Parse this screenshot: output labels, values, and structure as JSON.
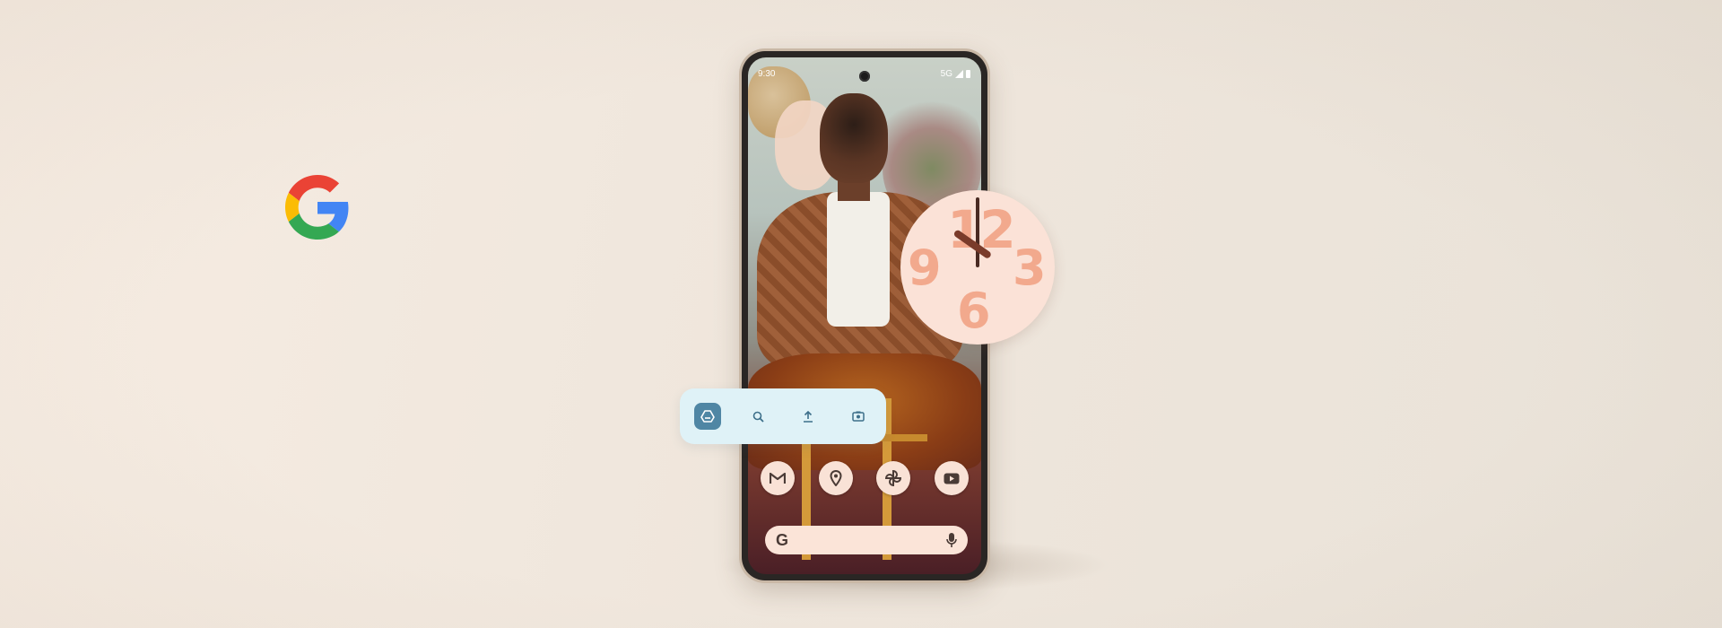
{
  "colors": {
    "background": "#f1e8de",
    "clock_face": "#fbe2d7",
    "clock_numbers": "#f2a98d",
    "toolbar_bg": "#dff2f7",
    "toolbar_active": "#4f86a4",
    "app_icon_bg": "#f9e2d6",
    "search_bar_bg": "#fbe4d8"
  },
  "brand": {
    "logo_icon": "google-g-logo-icon"
  },
  "status_bar": {
    "time": "9:30",
    "network": "5G",
    "icons": [
      "signal-icon",
      "battery-icon"
    ]
  },
  "clock_widget": {
    "numbers": [
      "12",
      "3",
      "6",
      "9"
    ],
    "time_shown": "10:00"
  },
  "toolbar": {
    "buttons": [
      {
        "icon": "drive-icon",
        "active": true
      },
      {
        "icon": "search-icon",
        "active": false
      },
      {
        "icon": "upload-icon",
        "active": false
      },
      {
        "icon": "camera-scan-icon",
        "active": false
      }
    ]
  },
  "dock": {
    "apps": [
      "gmail-icon",
      "maps-icon",
      "pinwheel-icon",
      "youtube-icon"
    ]
  },
  "search_bar": {
    "logo": "G",
    "mic_icon": "microphone-icon"
  }
}
